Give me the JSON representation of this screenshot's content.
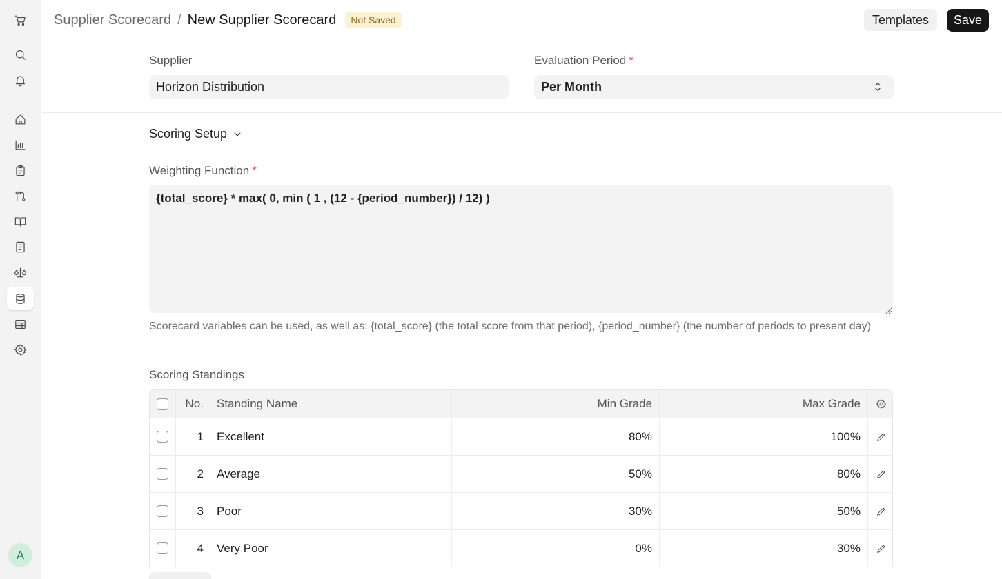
{
  "header": {
    "breadcrumb_parent": "Supplier Scorecard",
    "breadcrumb_separator": "/",
    "title": "New Supplier Scorecard",
    "status_badge": "Not Saved",
    "templates_label": "Templates",
    "save_label": "Save"
  },
  "sidebar": {
    "items": [
      {
        "icon": "cart-icon"
      },
      {
        "icon": "search-icon"
      },
      {
        "icon": "bell-icon"
      },
      {
        "icon": "home-icon"
      },
      {
        "icon": "bar-chart-icon"
      },
      {
        "icon": "clipboard-icon"
      },
      {
        "icon": "git-compare-icon"
      },
      {
        "icon": "book-open-icon"
      },
      {
        "icon": "file-text-icon"
      },
      {
        "icon": "scale-icon"
      },
      {
        "icon": "database-icon",
        "active": true
      },
      {
        "icon": "table-icon"
      },
      {
        "icon": "settings-icon"
      }
    ],
    "avatar_initial": "A"
  },
  "form": {
    "supplier_label": "Supplier",
    "supplier_value": "Horizon Distribution",
    "evaluation_period_label": "Evaluation Period",
    "evaluation_period_value": "Per Month",
    "required_mark": "*",
    "section_title": "Scoring Setup",
    "weighting_label": "Weighting Function",
    "weighting_value": "{total_score} * max( 0, min ( 1 , (12 - {period_number}) / 12) )",
    "help_text": "Scorecard variables can be used, as well as: {total_score} (the total score from that period), {period_number} (the number of periods to present day)"
  },
  "standings": {
    "title": "Scoring Standings",
    "columns": {
      "no": "No.",
      "name": "Standing Name",
      "min": "Min Grade",
      "max": "Max Grade"
    },
    "rows": [
      {
        "no": "1",
        "name": "Excellent",
        "min": "80%",
        "max": "100%"
      },
      {
        "no": "2",
        "name": "Average",
        "min": "50%",
        "max": "80%"
      },
      {
        "no": "3",
        "name": "Poor",
        "min": "30%",
        "max": "50%"
      },
      {
        "no": "4",
        "name": "Very Poor",
        "min": "0%",
        "max": "30%"
      }
    ]
  }
}
